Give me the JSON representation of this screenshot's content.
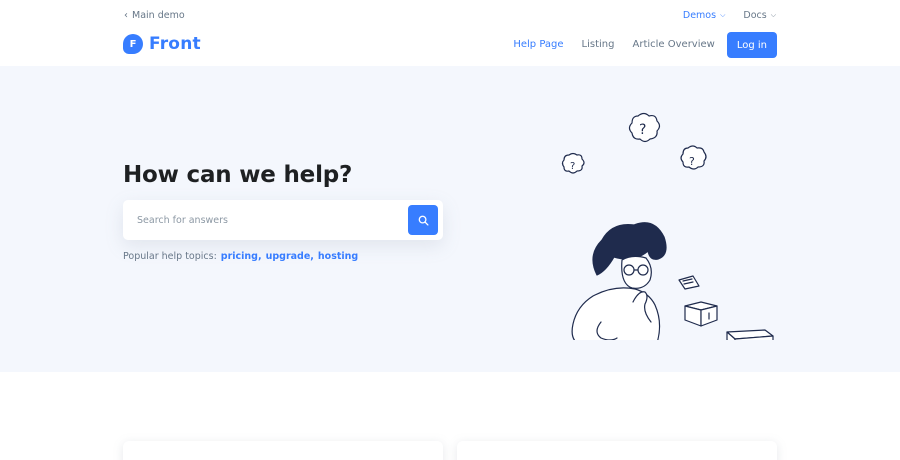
{
  "topbar": {
    "back_link": "Main demo",
    "menus": [
      {
        "label": "Demos",
        "active": true
      },
      {
        "label": "Docs",
        "active": false
      }
    ]
  },
  "brand": {
    "logo_letter": "F",
    "name": "Front",
    "color": "#377dff"
  },
  "nav": {
    "links": [
      {
        "label": "Help Page",
        "active": true
      },
      {
        "label": "Listing",
        "active": false
      },
      {
        "label": "Article Overview",
        "active": false
      }
    ],
    "login_label": "Log in"
  },
  "hero": {
    "title": "How can we help?",
    "search": {
      "placeholder": "Search for answers",
      "value": ""
    },
    "topics_label": "Popular help topics:",
    "topics": [
      "pricing,",
      "upgrade,",
      "hosting"
    ],
    "background": "#f4f7fd"
  },
  "icons": {
    "back": "chevron-left-icon",
    "menu_caret": "chevron-down-icon",
    "search": "search-icon"
  }
}
